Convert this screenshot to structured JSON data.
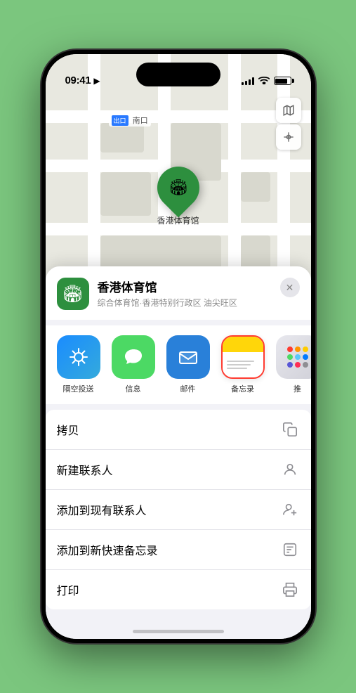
{
  "status_bar": {
    "time": "09:41",
    "location_arrow": "▶"
  },
  "map": {
    "label": "南口",
    "pin_label": "香港体育馆",
    "map_icon": "🗺",
    "location_icon": "⬆"
  },
  "venue": {
    "name": "香港体育馆",
    "subtitle": "综合体育馆·香港特别行政区 油尖旺区",
    "close_label": "×",
    "icon": "🏟"
  },
  "share_items": [
    {
      "id": "airdrop",
      "label": "隔空投送",
      "icon_type": "airdrop"
    },
    {
      "id": "message",
      "label": "信息",
      "icon_type": "message"
    },
    {
      "id": "mail",
      "label": "邮件",
      "icon_type": "mail"
    },
    {
      "id": "notes",
      "label": "备忘录",
      "icon_type": "notes"
    },
    {
      "id": "more",
      "label": "推",
      "icon_type": "more"
    }
  ],
  "actions": [
    {
      "label": "拷贝",
      "icon": "copy"
    },
    {
      "label": "新建联系人",
      "icon": "person"
    },
    {
      "label": "添加到现有联系人",
      "icon": "person-add"
    },
    {
      "label": "添加到新快速备忘录",
      "icon": "note"
    },
    {
      "label": "打印",
      "icon": "printer"
    }
  ],
  "dots": [
    "#ff3b30",
    "#ff9500",
    "#ffcc00",
    "#4cd964",
    "#5ac8fa",
    "#007aff",
    "#5856d6",
    "#ff2d55",
    "#8e8e93"
  ]
}
